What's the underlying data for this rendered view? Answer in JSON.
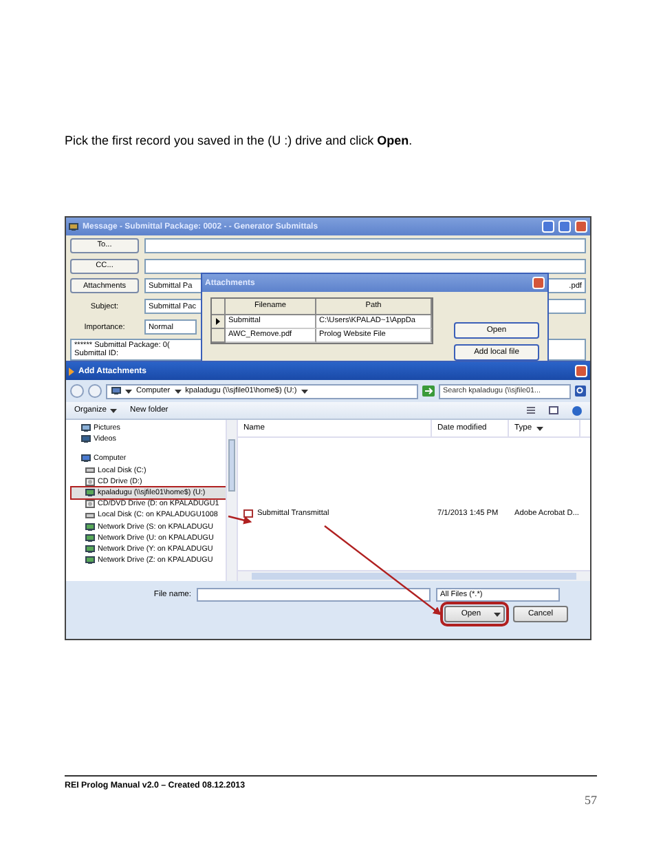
{
  "instruction": "Pick the first record you saved in the (U :) drive and click **Open**.",
  "message_window": {
    "title": "Message - Submittal Package: 0002 - - Generator Submittals",
    "fields": [
      {
        "kind": "button",
        "label": "To..."
      },
      {
        "kind": "button",
        "label": "CC..."
      },
      {
        "kind": "button",
        "label": "Attachments",
        "value": "Submittal Pa",
        "value_end": ".pdf"
      },
      {
        "kind": "label",
        "label": "Subject:",
        "value": "Submittal Pac"
      },
      {
        "kind": "label",
        "label": "Importance:",
        "value": "Normal"
      }
    ],
    "body": [
      "****** Submittal Package: 0(",
      "Submittal ID:"
    ]
  },
  "attachments_dialog": {
    "title": "Attachments",
    "columns": [
      "Filename",
      "Path"
    ],
    "rows": [
      {
        "selected": true,
        "cells": [
          "Submittal",
          "C:\\Users\\KPALAD~1\\AppDa"
        ]
      },
      {
        "selected": false,
        "cells": [
          "AWC_Remove.pdf",
          "Prolog Website File"
        ]
      }
    ],
    "buttons": [
      "Open",
      "Add local file"
    ]
  },
  "add_attachments": {
    "title": "Add Attachments",
    "breadcrumb": [
      "Computer",
      "kpaladugu (\\\\sjfile01\\home$) (U:)"
    ],
    "search": {
      "placeholder": "Search kpaladugu (\\\\sjfile01..."
    },
    "toolbar": [
      "Organize",
      "New folder"
    ],
    "nav": [
      {
        "kind": "pictures",
        "label": "Pictures",
        "highlighted": false
      },
      {
        "kind": "videos",
        "label": "Videos",
        "highlighted": false
      },
      {
        "kind": "computer",
        "label": "Computer",
        "highlighted": false,
        "children": [
          {
            "kind": "disk",
            "label": "Local Disk (C:)",
            "highlighted": false
          },
          {
            "kind": "cd",
            "label": "CD Drive (D:)",
            "highlighted": false
          },
          {
            "kind": "network",
            "label": "kpaladugu (\\\\sjfile01\\home$) (U:)",
            "highlighted": true
          },
          {
            "kind": "cd",
            "label": "CD/DVD Drive (D: on KPALADUGU1",
            "highlighted": false
          },
          {
            "kind": "disk",
            "label": "Local Disk (C: on KPALADUGU1008",
            "highlighted": false
          },
          {
            "kind": "network",
            "label": "Network Drive (S: on KPALADUGU",
            "highlighted": false
          },
          {
            "kind": "network",
            "label": "Network Drive (U: on KPALADUGU",
            "highlighted": false
          },
          {
            "kind": "network",
            "label": "Network Drive (Y: on KPALADUGU",
            "highlighted": false
          },
          {
            "kind": "network",
            "label": "Network Drive (Z: on KPALADUGU",
            "highlighted": false
          }
        ]
      }
    ],
    "columns": [
      "Name",
      "Date modified",
      "Type"
    ],
    "files": [
      {
        "name": "Submittal Transmittal",
        "date": "7/1/2013 1:45 PM",
        "type": "Adobe Acrobat D..."
      }
    ],
    "file_name_label": "File name:",
    "filter": "All Files (*.*)",
    "buttons": [
      {
        "label": "Open",
        "highlighted": true,
        "kind": "split"
      },
      {
        "label": "Cancel",
        "highlighted": false,
        "kind": "plain"
      }
    ]
  },
  "footer": {
    "text": "REI Prolog Manual v2.0 – Created 08.12.2013",
    "page": "57"
  }
}
